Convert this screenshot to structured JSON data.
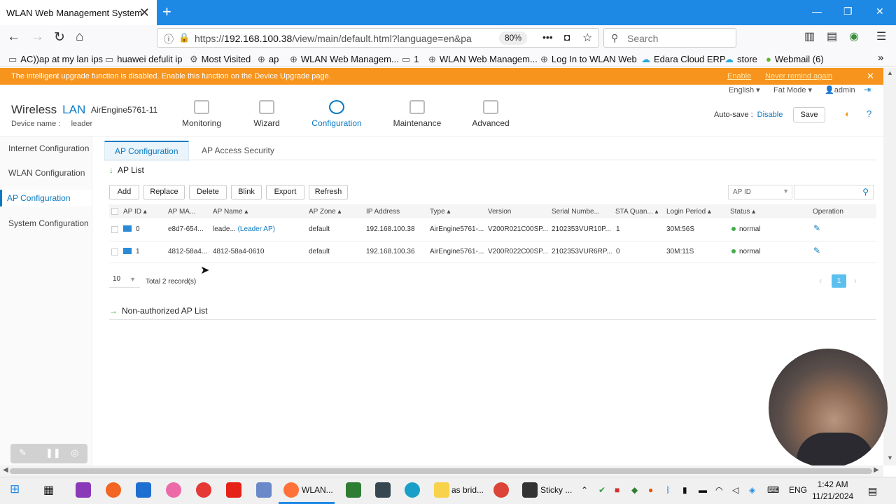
{
  "browser": {
    "tab_title": "WLAN Web Management System",
    "url_prefix": "https://",
    "url_host": "192.168.100.38",
    "url_path": "/view/main/default.html?language=en&pa",
    "zoom": "80%",
    "search_placeholder": "Search",
    "bookmarks": [
      "AC))ap at my lan ips",
      "huawei defulit ip",
      "Most Visited",
      "ap",
      "WLAN Web Managem...",
      "1",
      "WLAN Web Managem...",
      "Log In to WLAN Web",
      "Edara Cloud ERP",
      "store",
      "Webmail (6)"
    ]
  },
  "banner": {
    "text": "The intelligent upgrade function is disabled. Enable this function on the Device Upgrade page.",
    "enable": "Enable",
    "never_remind": "Never remind again"
  },
  "topbar": {
    "language": "English",
    "mode": "Fat Mode",
    "user": "admin"
  },
  "header": {
    "brand_wireless": "Wireless",
    "brand_lan": "LAN",
    "model": "AirEngine5761-11",
    "device_name_label": "Device name :",
    "device_name": "leader",
    "nav": [
      "Monitoring",
      "Wizard",
      "Configuration",
      "Maintenance",
      "Advanced"
    ],
    "autosave_label": "Auto-save :",
    "autosave_value": "Disable",
    "save": "Save"
  },
  "sidebar": [
    "Internet Configuration",
    "WLAN Configuration",
    "AP Configuration",
    "System Configuration"
  ],
  "subtabs": [
    "AP Configuration",
    "AP Access Security"
  ],
  "ap_list": {
    "title": "AP List",
    "buttons": [
      "Add",
      "Replace",
      "Delete",
      "Blink",
      "Export",
      "Refresh"
    ],
    "filter": "AP ID",
    "columns": [
      "AP ID",
      "AP MA...",
      "AP Name",
      "AP Zone",
      "IP Address",
      "Type",
      "Version",
      "Serial Numbe...",
      "STA Quan...",
      "Login Period",
      "Status",
      "Operation"
    ],
    "rows": [
      {
        "id": "0",
        "mac": "e8d7-654...",
        "name": "leade...",
        "tag": "(Leader AP)",
        "zone": "default",
        "ip": "192.168.100.38",
        "type": "AirEngine5761-...",
        "version": "V200R021C00SP...",
        "serial": "2102353VUR10P...",
        "sta": "1",
        "login": "30M:56S",
        "status": "normal"
      },
      {
        "id": "1",
        "mac": "4812-58a4...",
        "name": "4812-58a4-0610",
        "tag": "",
        "zone": "default",
        "ip": "192.168.100.36",
        "type": "AirEngine5761-...",
        "version": "V200R022C00SP...",
        "serial": "2102353VUR6RP...",
        "sta": "0",
        "login": "30M:11S",
        "status": "normal"
      }
    ],
    "page_size": "10",
    "total": "Total 2 record(s)",
    "page": "1"
  },
  "nonauth_title": "Non-authorized AP List",
  "taskbar": {
    "items": [
      "WLAN...",
      "as brid...",
      "Sticky ..."
    ],
    "lang": "ENG",
    "time": "1:42 AM",
    "date": "11/21/2024"
  },
  "colors": {
    "accent": "#0b7ac2",
    "banner": "#f7941d",
    "browser_bar": "#1e88e5",
    "status_ok": "#3fae49"
  }
}
